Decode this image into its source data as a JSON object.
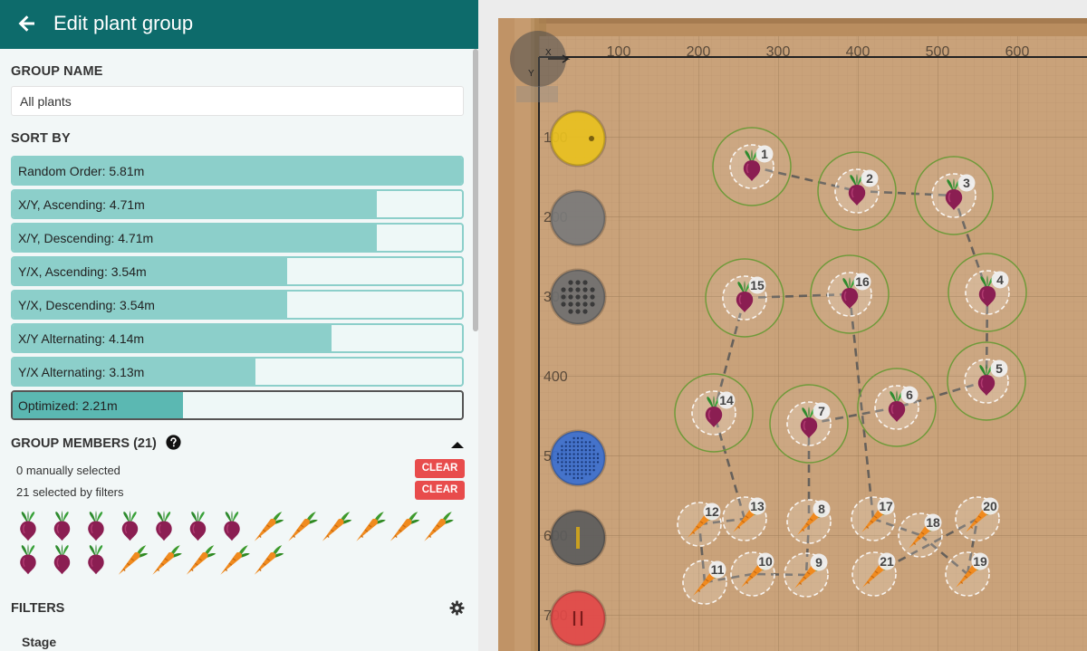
{
  "header": {
    "title": "Edit plant group",
    "back_icon": "arrow-left-icon"
  },
  "group_name": {
    "label": "GROUP NAME",
    "value": "All plants"
  },
  "sort_by": {
    "label": "SORT BY",
    "options": [
      {
        "label": "Random Order: 5.81m",
        "fill": 1.0,
        "selected": false
      },
      {
        "label": "X/Y, Ascending: 4.71m",
        "fill": 0.81,
        "selected": false
      },
      {
        "label": "X/Y, Descending: 4.71m",
        "fill": 0.81,
        "selected": false
      },
      {
        "label": "Y/X, Ascending: 3.54m",
        "fill": 0.61,
        "selected": false
      },
      {
        "label": "Y/X, Descending: 3.54m",
        "fill": 0.61,
        "selected": false
      },
      {
        "label": "X/Y Alternating: 4.14m",
        "fill": 0.71,
        "selected": false
      },
      {
        "label": "Y/X Alternating: 3.13m",
        "fill": 0.54,
        "selected": false
      },
      {
        "label": "Optimized: 2.21m",
        "fill": 0.38,
        "selected": true
      }
    ]
  },
  "members": {
    "title": "GROUP MEMBERS (21)",
    "help_icon": "question-circle-icon",
    "collapse_icon": "caret-up-icon",
    "manually_selected": "0 manually selected",
    "selected_by_filters": "21 selected by filters",
    "clear_label": "CLEAR",
    "icons_row1": [
      "beet",
      "beet",
      "beet",
      "beet",
      "beet",
      "beet",
      "beet",
      "carrot",
      "carrot",
      "carrot",
      "carrot",
      "carrot",
      "carrot"
    ],
    "icons_row2": [
      "beet",
      "beet",
      "beet",
      "carrot",
      "carrot",
      "carrot",
      "carrot",
      "carrot"
    ]
  },
  "filters": {
    "title": "FILTERS",
    "gear_icon": "gear-icon",
    "stage_label": "Stage"
  },
  "map": {
    "x_ticks": [
      "100",
      "200",
      "300",
      "400",
      "500",
      "600"
    ],
    "y_ticks": [
      "100",
      "200",
      "300",
      "400",
      "500",
      "600",
      "700"
    ],
    "axis_x_label": "X",
    "axis_y_label": "Y",
    "colors": {
      "soil": "#c9a27a",
      "border": "#b98d5f",
      "path": "#555555",
      "spread": "#6f9a3a"
    },
    "tools": [
      {
        "name": "yellow-tool",
        "color": "#e8c020"
      },
      {
        "name": "gray-tool",
        "color": "#7a7a7a"
      },
      {
        "name": "seeder-tool",
        "color": "#6f6f6f"
      },
      {
        "name": "blue-watering-tool",
        "color": "#3a6fd0"
      },
      {
        "name": "weeder-tool",
        "color": "#5c5c5c"
      },
      {
        "name": "red-tool",
        "color": "#e24848"
      }
    ],
    "plants": [
      {
        "n": "1",
        "type": "beet",
        "x": 302,
        "y": 184
      },
      {
        "n": "2",
        "type": "beet",
        "x": 418,
        "y": 211
      },
      {
        "n": "3",
        "type": "beet",
        "x": 525,
        "y": 216
      },
      {
        "n": "4",
        "type": "beet",
        "x": 562,
        "y": 323
      },
      {
        "n": "5",
        "type": "beet",
        "x": 561,
        "y": 421
      },
      {
        "n": "6",
        "type": "beet",
        "x": 462,
        "y": 450
      },
      {
        "n": "7",
        "type": "beet",
        "x": 365,
        "y": 468
      },
      {
        "n": "8",
        "type": "carrot",
        "x": 365,
        "y": 576
      },
      {
        "n": "9",
        "type": "carrot",
        "x": 362,
        "y": 635
      },
      {
        "n": "10",
        "type": "carrot",
        "x": 303,
        "y": 634
      },
      {
        "n": "11",
        "type": "carrot",
        "x": 250,
        "y": 643
      },
      {
        "n": "12",
        "type": "carrot",
        "x": 244,
        "y": 579
      },
      {
        "n": "13",
        "type": "carrot",
        "x": 294,
        "y": 573
      },
      {
        "n": "14",
        "type": "beet",
        "x": 260,
        "y": 456
      },
      {
        "n": "15",
        "type": "beet",
        "x": 294,
        "y": 329
      },
      {
        "n": "16",
        "type": "beet",
        "x": 410,
        "y": 325
      },
      {
        "n": "17",
        "type": "carrot",
        "x": 436,
        "y": 573
      },
      {
        "n": "18",
        "type": "carrot",
        "x": 488,
        "y": 591
      },
      {
        "n": "19",
        "type": "carrot",
        "x": 540,
        "y": 634
      },
      {
        "n": "20",
        "type": "carrot",
        "x": 551,
        "y": 573
      },
      {
        "n": "21",
        "type": "carrot",
        "x": 437,
        "y": 634
      }
    ]
  }
}
